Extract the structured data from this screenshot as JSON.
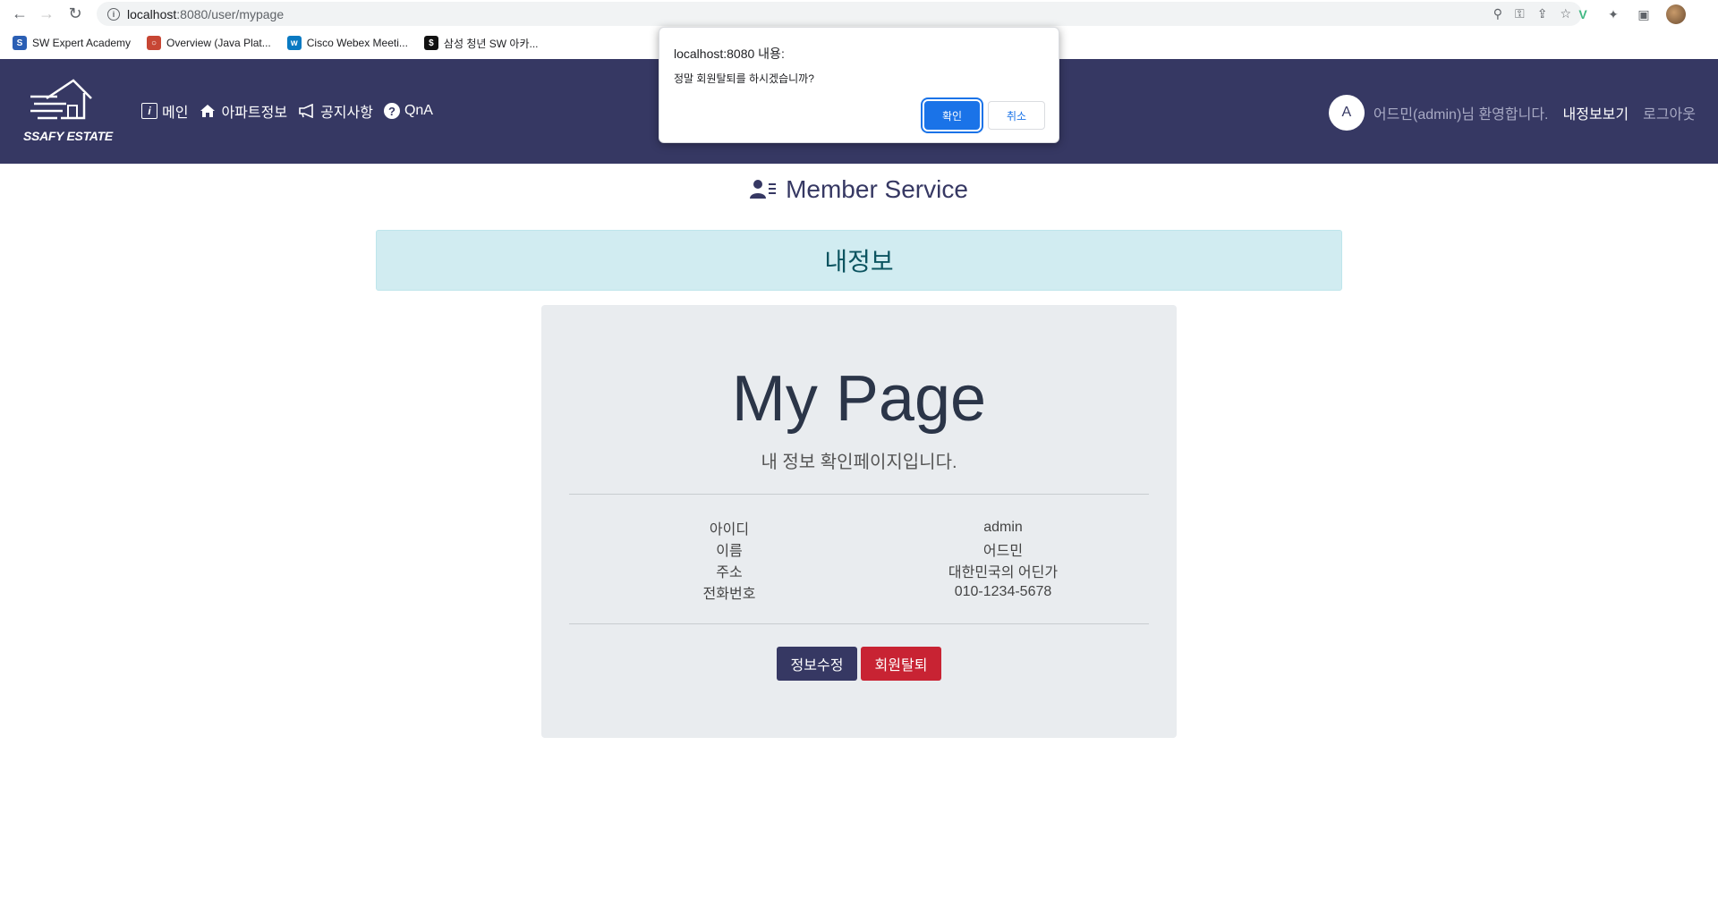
{
  "browser": {
    "url_host": "localhost",
    "url_path": ":8080/user/mypage",
    "bookmarks": [
      {
        "label": "SW Expert Academy",
        "icon": "swea-icon",
        "color": "#2b5fb4",
        "glyph": "S"
      },
      {
        "label": "Overview (Java Plat...",
        "icon": "oracle-icon",
        "color": "#c74634",
        "glyph": "○"
      },
      {
        "label": "Cisco Webex Meeti...",
        "icon": "webex-icon",
        "color": "#0a7ac2",
        "glyph": "w"
      },
      {
        "label": "삼성 청년 SW 아카...",
        "icon": "ssafy-bookmark-icon",
        "color": "#111111",
        "glyph": "$"
      }
    ]
  },
  "navbar": {
    "logo_text": "SSAFY ESTATE",
    "menu": [
      {
        "label": "메인",
        "icon": "info-icon"
      },
      {
        "label": "아파트정보",
        "icon": "home-icon"
      },
      {
        "label": "공지사항",
        "icon": "megaphone-icon"
      },
      {
        "label": "QnA",
        "icon": "question-icon"
      }
    ],
    "avatar_letter": "A",
    "welcome": "어드민(admin)님 환영합니다.",
    "mypage": "내정보보기",
    "logout": "로그아웃"
  },
  "main": {
    "section_title": "Member Service",
    "alert": "내정보",
    "page_title": "My Page",
    "subtitle": "내 정보 확인페이지입니다.",
    "info": [
      {
        "label": "아이디",
        "value": "admin"
      },
      {
        "label": "이름",
        "value": "어드민"
      },
      {
        "label": "주소",
        "value": "대한민국의 어딘가"
      },
      {
        "label": "전화번호",
        "value": "010-1234-5678"
      }
    ],
    "edit_button": "정보수정",
    "delete_button": "회원탈퇴"
  },
  "dialog": {
    "title": "localhost:8080 내용:",
    "message": "정말 회원탈퇴를 하시겠습니까?",
    "ok": "확인",
    "cancel": "취소"
  }
}
